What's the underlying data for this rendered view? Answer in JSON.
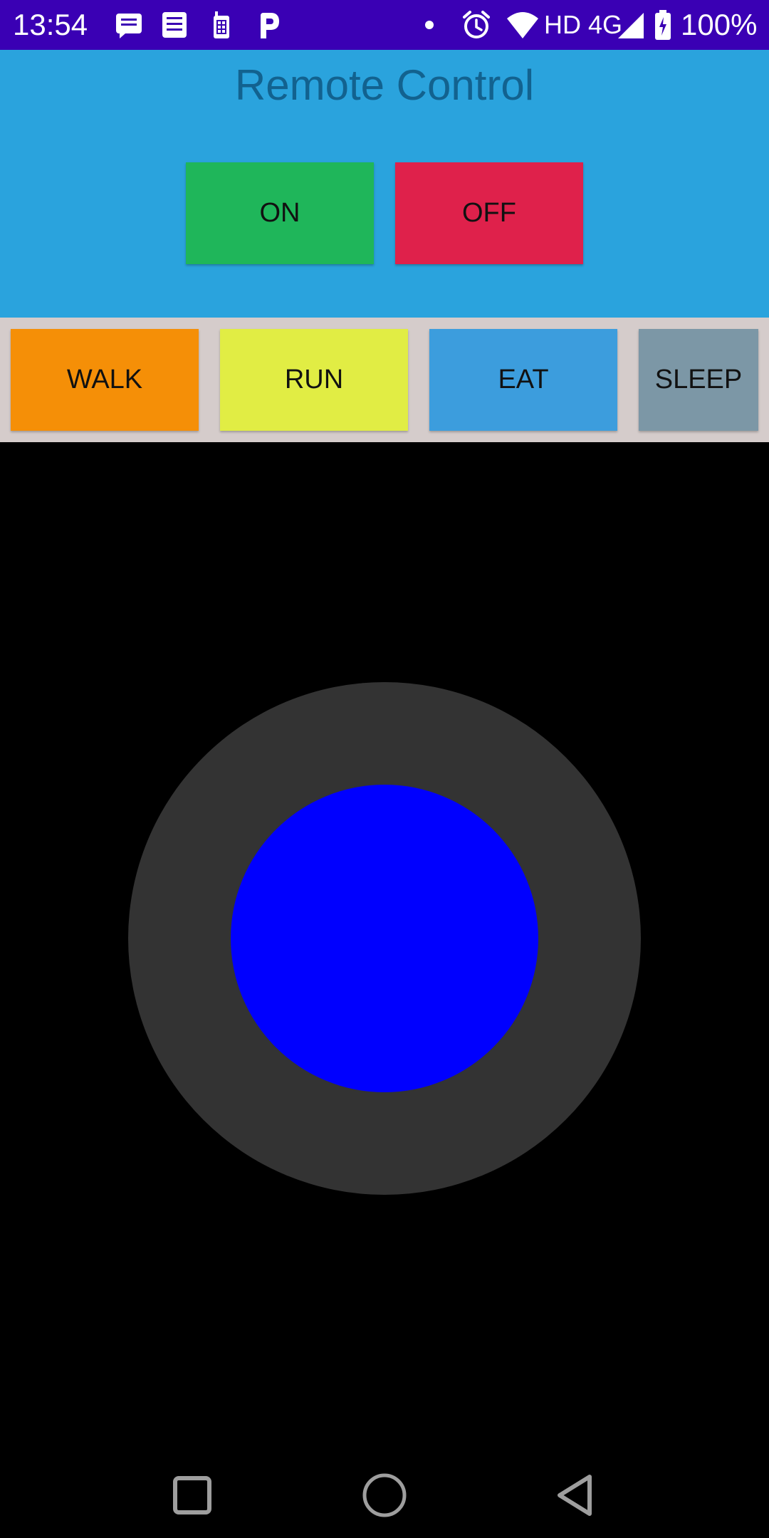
{
  "status_bar": {
    "time": "13:54",
    "network": "HD 4G",
    "battery": "100%",
    "icons": [
      "message-icon",
      "document-icon",
      "sim-icon",
      "p-icon",
      "dot-icon",
      "alarm-icon",
      "wifi-icon",
      "signal-icon",
      "battery-icon"
    ]
  },
  "header": {
    "title": "Remote Control",
    "on_label": "ON",
    "off_label": "OFF"
  },
  "actions": {
    "walk": "WALK",
    "run": "RUN",
    "eat": "EAT",
    "sleep": "SLEEP"
  },
  "colors": {
    "status_bar": "#3a00b4",
    "header_bg": "#2aa3dd",
    "title_text": "#12628f",
    "on": "#1fb65a",
    "off": "#df214b",
    "walk": "#f58f07",
    "run": "#e1ed44",
    "eat": "#3c9ddd",
    "sleep": "#7c97a6",
    "joystick_base": "#333333",
    "joystick_knob": "#0000ff"
  },
  "nav": {
    "icons": [
      "recents-icon",
      "home-icon",
      "back-icon"
    ]
  }
}
